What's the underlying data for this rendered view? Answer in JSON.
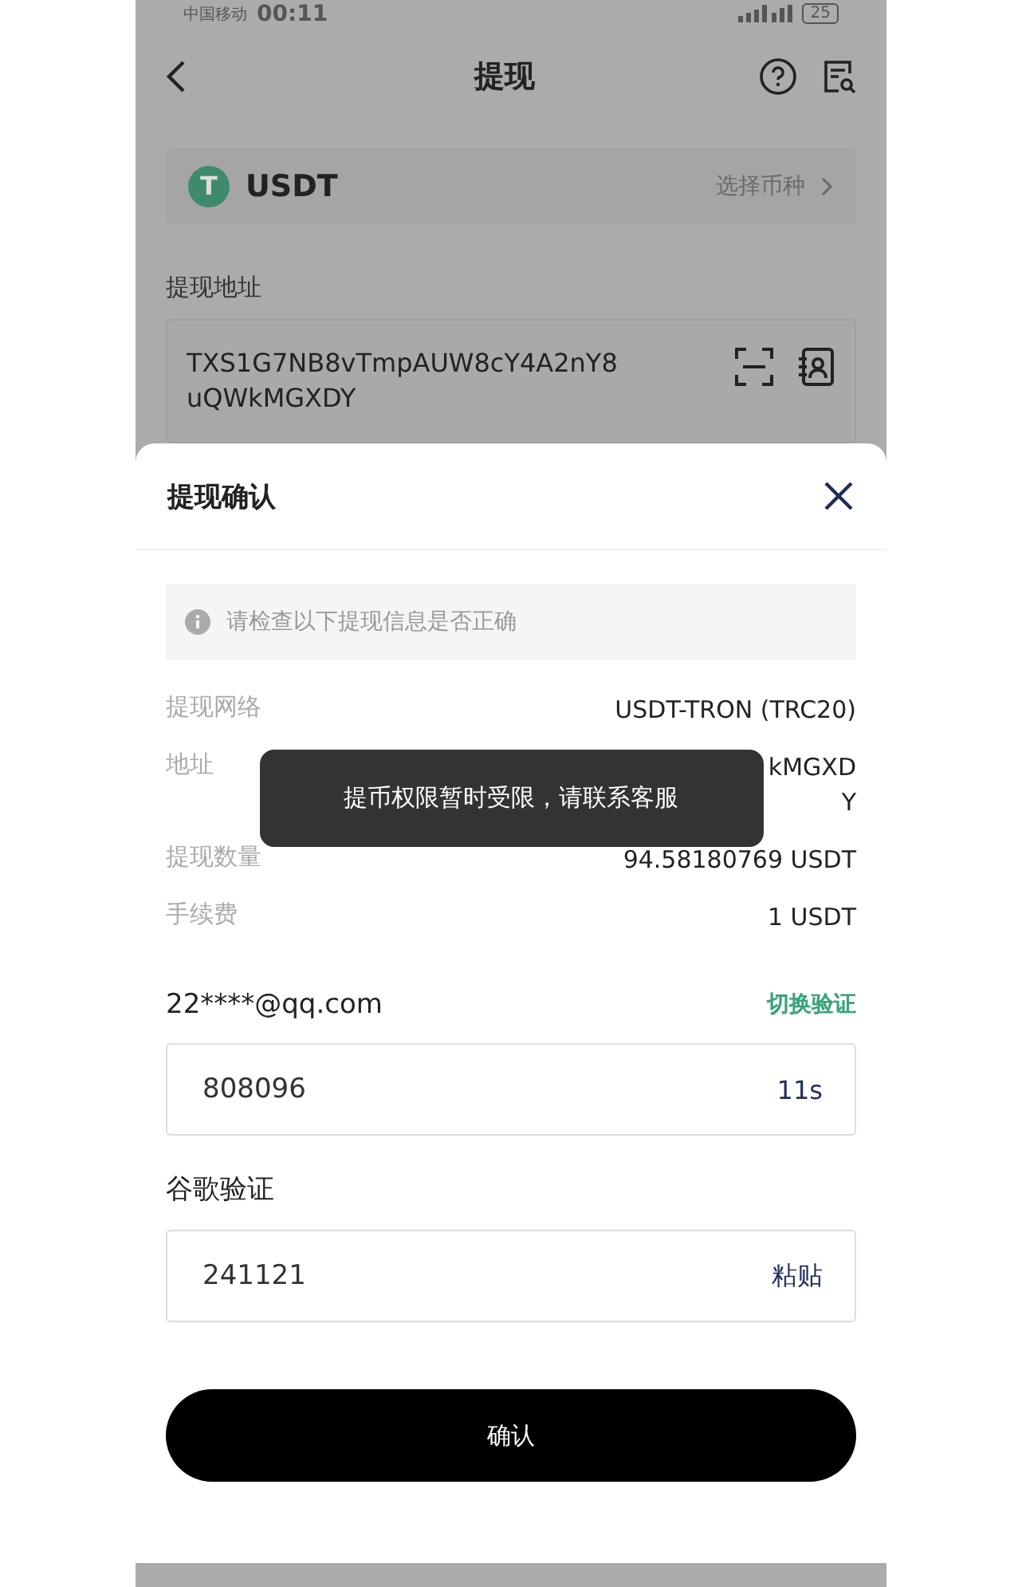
{
  "status_bar": {
    "carrier": "中国移动",
    "time": "00:11",
    "battery": "25"
  },
  "header": {
    "title": "提现"
  },
  "coin": {
    "name": "USDT",
    "symbol": "T",
    "action": "选择币种"
  },
  "address_field": {
    "label": "提现地址",
    "value_lines": [
      "TXS1G7NB8vTmpAUW8cY4A2nY8",
      "uQWkMGXDY"
    ]
  },
  "sheet": {
    "title": "提现确认",
    "notice": "请检查以下提现信息是否正确",
    "rows": [
      {
        "label": "提现网络",
        "value_lines": [
          "USDT-TRON (TRC20)"
        ]
      },
      {
        "label": "地址",
        "value_lines": [
          "kMGXD",
          "Y"
        ]
      },
      {
        "label": "提现数量",
        "value_lines": [
          "94.58180769 USDT"
        ]
      },
      {
        "label": "手续费",
        "value_lines": [
          "1 USDT"
        ]
      }
    ],
    "email": {
      "label": "22****@qq.com",
      "switch": "切换验证",
      "value": "808096",
      "action": "11s"
    },
    "google": {
      "label": "谷歌验证",
      "value": "241121",
      "action": "粘贴"
    },
    "confirm": "确认"
  },
  "toast": "提币权限暂时受限，请联系客服"
}
